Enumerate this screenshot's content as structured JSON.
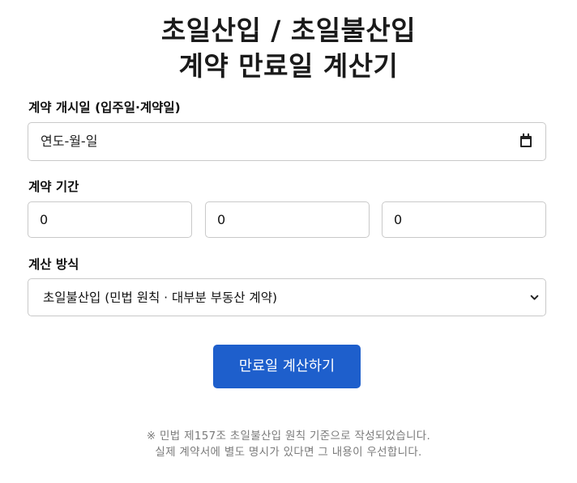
{
  "header": {
    "title_line1": "초일산입 / 초일불산입",
    "title_line2": "계약 만료일 계산기"
  },
  "form": {
    "start_date": {
      "label": "계약 개시일 (입주일·계약일)",
      "placeholder": "연도-월-일",
      "icon": "calendar-icon"
    },
    "period": {
      "label": "계약 기간",
      "fields": [
        {
          "value": "0"
        },
        {
          "value": "0"
        },
        {
          "value": "0"
        }
      ]
    },
    "method": {
      "label": "계산 방식",
      "selected": "초일불산입 (민법 원칙 · 대부분 부동산 계약)",
      "icon": "chevron-down-icon"
    }
  },
  "actions": {
    "calculate_label": "만료일 계산하기"
  },
  "footer": {
    "note_line1": "※ 민법 제157조 초일불산입 원칙 기준으로 작성되었습니다.",
    "note_line2": "실제 계약서에 별도 명시가 있다면 그 내용이 우선합니다."
  },
  "colors": {
    "accent": "#1e5fcc",
    "border": "#c9c9c9",
    "note_text": "#7a7a7a"
  }
}
